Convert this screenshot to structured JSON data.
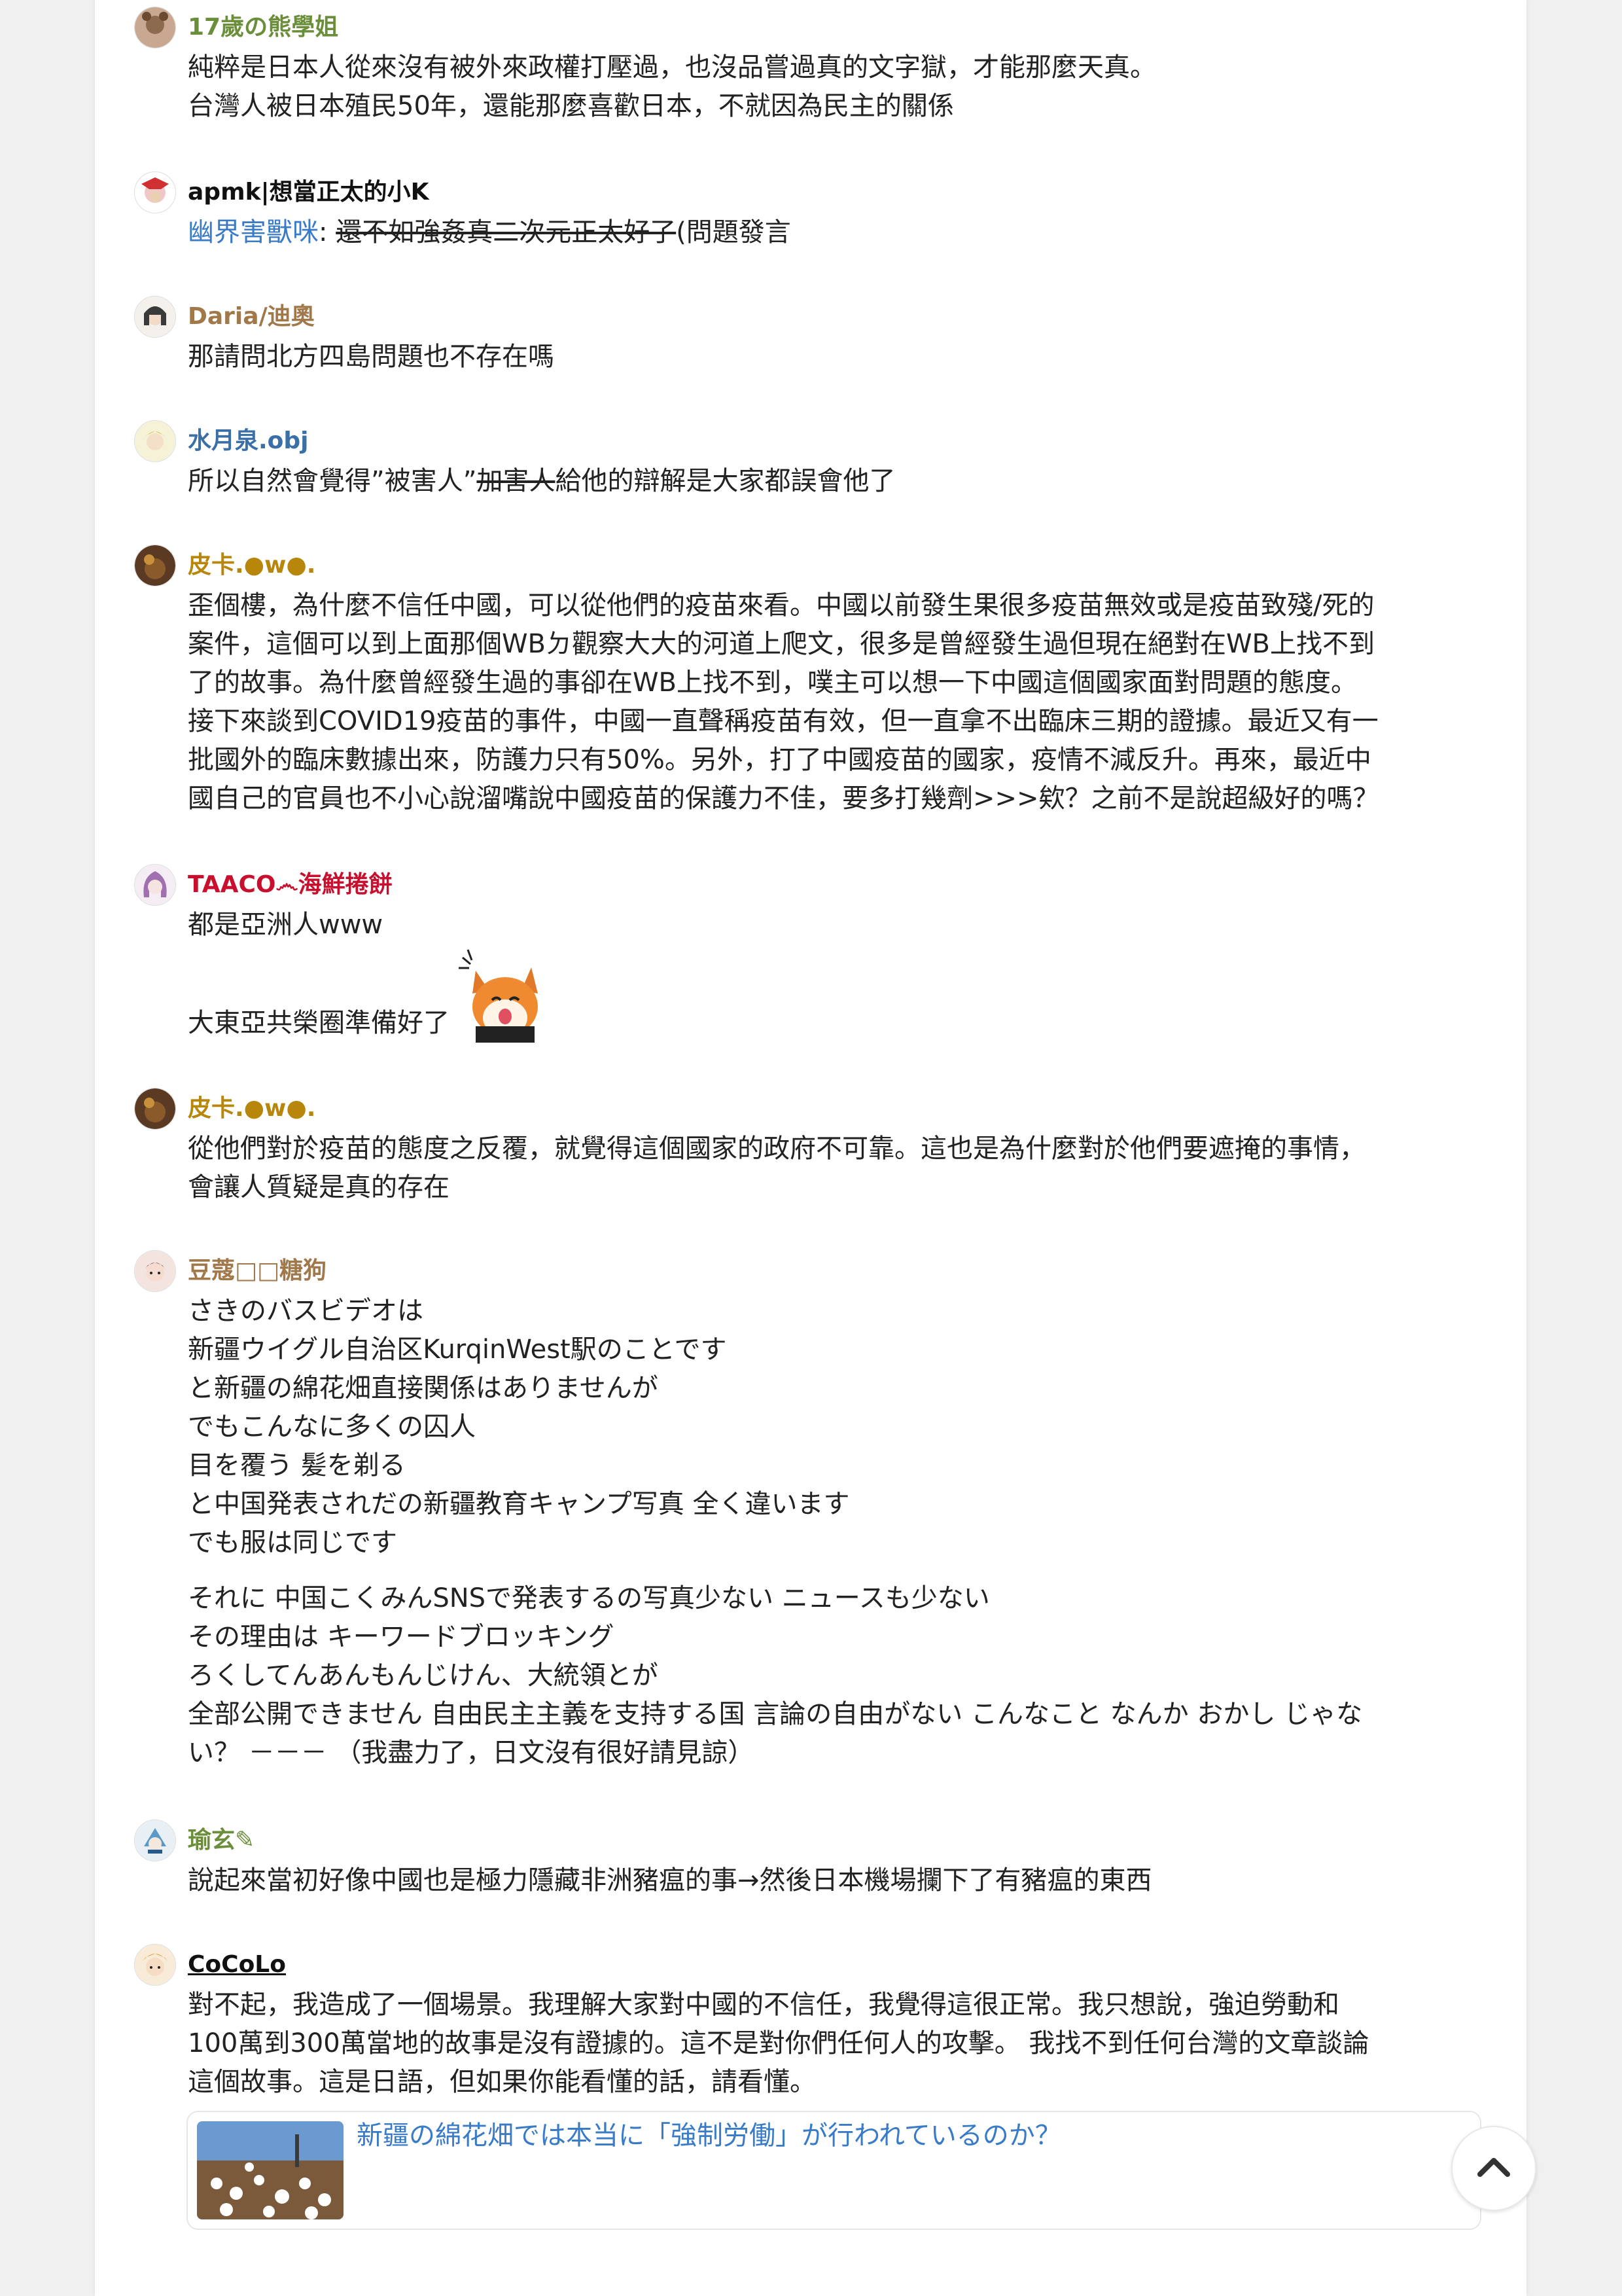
{
  "comments": [
    {
      "author": "17歲の熊學姐",
      "author_color": "#6b8e3a",
      "lines": [
        "純粹是日本人從來沒有被外來政權打壓過，也沒品嘗過真的文字獄，才能那麼天真。",
        "台灣人被日本殖民50年，還能那麼喜歡日本，不就因為民主的關係"
      ]
    },
    {
      "author": "apmk|想當正太的小K",
      "author_color": "#111111",
      "mention": "幽界害獸咪",
      "mention_sep": ":",
      "struck": "還不如強姦真二次元正太好了",
      "after": "(問題發言"
    },
    {
      "author": "Daria/迪奧",
      "author_color": "#a0784a",
      "lines": [
        "那請問北方四島問題也不存在嗎"
      ]
    },
    {
      "author": "水月泉.obj",
      "author_color": "#3a6fa8",
      "pre": "所以自然會覺得”被害人”",
      "struck": "加害人",
      "after": "給他的辯解是大家都誤會他了"
    },
    {
      "author": "皮卡.●w●.",
      "author_color": "#b8860b",
      "lines": [
        "歪個樓，為什麼不信任中國，可以從他們的疫苗來看。中國以前發生果很多疫苗無效或是疫苗致殘/死的",
        "案件，這個可以到上面那個WBㄉ觀察大大的河道上爬文，很多是曾經發生過但現在絕對在WB上找不到",
        "了的故事。為什麼曾經發生過的事卻在WB上找不到，噗主可以想一下中國這個國家面對問題的態度。",
        "接下來談到COVID19疫苗的事件，中國一直聲稱疫苗有效，但一直拿不出臨床三期的證據。最近又有一",
        "批國外的臨床數據出來，防護力只有50%。另外，打了中國疫苗的國家，疫情不減反升。再來，最近中",
        "國自己的官員也不小心說溜嘴說中國疫苗的保護力不佳，要多打幾劑>>>欸？之前不是說超級好的嗎？"
      ]
    },
    {
      "author": "TAACO෴海鮮捲餅",
      "author_color": "#c8102e",
      "lines": [
        "都是亞洲人www",
        "大東亞共榮圈準備好了"
      ]
    },
    {
      "author": "皮卡.●w●.",
      "author_color": "#b8860b",
      "lines": [
        "從他們對於疫苗的態度之反覆，就覺得這個國家的政府不可靠。這也是為什麼對於他們要遮掩的事情，",
        "會讓人質疑是真的存在"
      ]
    },
    {
      "author": "豆蔻□□糖狗",
      "author_color": "#a0784a",
      "lines": [
        "さきのバスビデオは",
        "新疆ウイグル自治区KurqinWest駅のことです",
        "と新疆の綿花畑直接関係はありませんが",
        "でもこんなに多くの囚人",
        "目を覆う 髪を剃る",
        "と中国発表されだの新疆教育キャンプ写真 全く違います",
        "でも服は同じです"
      ],
      "lines2": [
        "それに 中国こくみんSNSで発表するの写真少ない ニュースも少ない",
        "その理由は キーワードブロッキング",
        "ろくしてんあんもんじけん、大統領とが",
        "全部公開できません 自由民主主義を支持する国 言論の自由がない こんなこと なんか おかし じゃな",
        "い？ －－－ （我盡力了，日文沒有很好請見諒）"
      ]
    },
    {
      "author": "瑜玄✎",
      "author_color": "#6b8e3a",
      "lines": [
        "說起來當初好像中國也是極力隱藏非洲豬瘟的事→然後日本機場攔下了有豬瘟的東西"
      ]
    },
    {
      "author": "CoCoLo",
      "author_color": "#111111",
      "lines": [
        "對不起，我造成了一個場景。我理解大家對中國的不信任，我覺得這很正常。我只想說，強迫勞動和",
        "100萬到300萬當地的故事是沒有證據的。這不是對你們任何人的攻擊。 我找不到任何台灣的文章談論",
        "這個故事。這是日語，但如果你能看懂的話，請看懂。"
      ],
      "link_title": "新疆の綿花畑では本当に「強制労働」が行われているのか？"
    }
  ],
  "icons": {
    "scroll_top": "chevron-up-icon",
    "sticker": "fox-sticker-icon"
  }
}
